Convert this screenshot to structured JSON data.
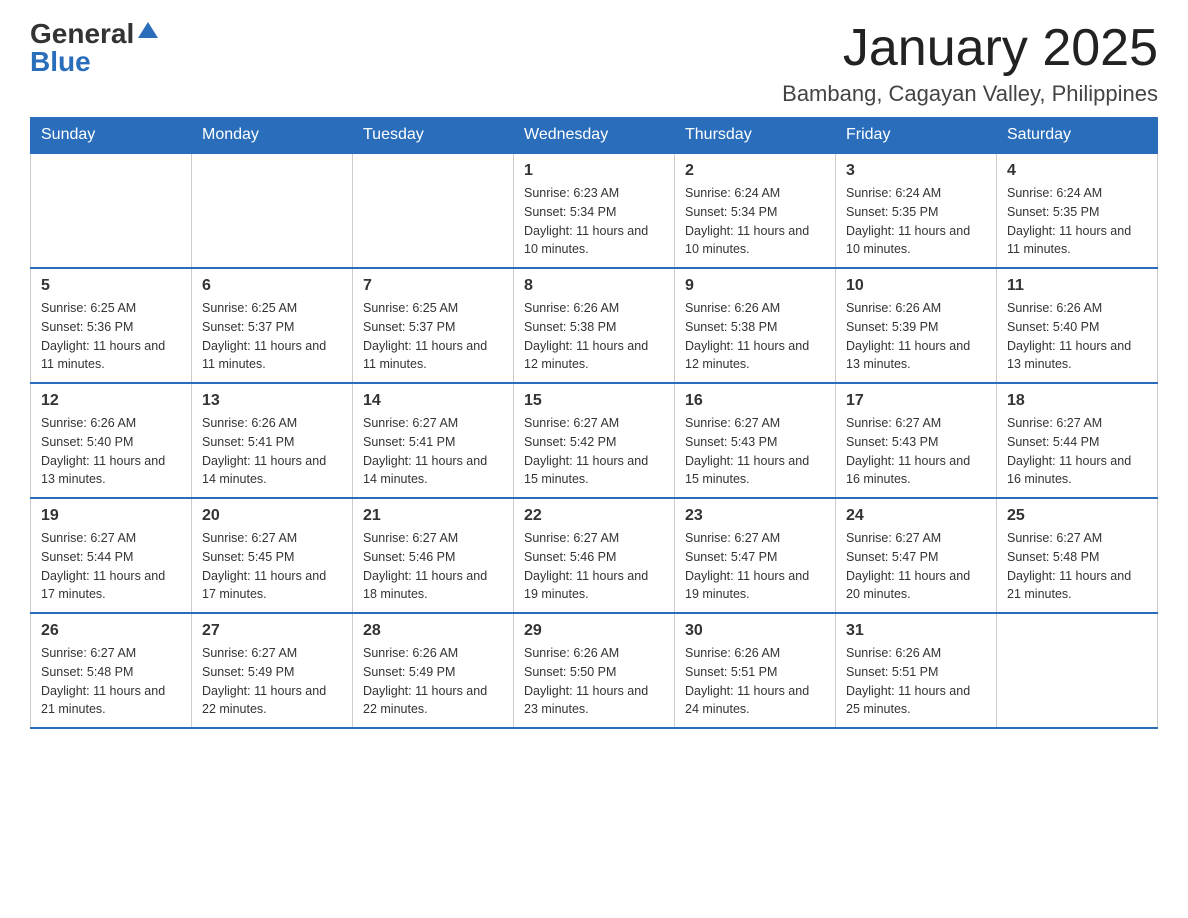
{
  "logo": {
    "general": "General",
    "blue": "Blue"
  },
  "header": {
    "month": "January 2025",
    "location": "Bambang, Cagayan Valley, Philippines"
  },
  "days_header": [
    "Sunday",
    "Monday",
    "Tuesday",
    "Wednesday",
    "Thursday",
    "Friday",
    "Saturday"
  ],
  "weeks": [
    [
      {
        "day": "",
        "info": ""
      },
      {
        "day": "",
        "info": ""
      },
      {
        "day": "",
        "info": ""
      },
      {
        "day": "1",
        "info": "Sunrise: 6:23 AM\nSunset: 5:34 PM\nDaylight: 11 hours and 10 minutes."
      },
      {
        "day": "2",
        "info": "Sunrise: 6:24 AM\nSunset: 5:34 PM\nDaylight: 11 hours and 10 minutes."
      },
      {
        "day": "3",
        "info": "Sunrise: 6:24 AM\nSunset: 5:35 PM\nDaylight: 11 hours and 10 minutes."
      },
      {
        "day": "4",
        "info": "Sunrise: 6:24 AM\nSunset: 5:35 PM\nDaylight: 11 hours and 11 minutes."
      }
    ],
    [
      {
        "day": "5",
        "info": "Sunrise: 6:25 AM\nSunset: 5:36 PM\nDaylight: 11 hours and 11 minutes."
      },
      {
        "day": "6",
        "info": "Sunrise: 6:25 AM\nSunset: 5:37 PM\nDaylight: 11 hours and 11 minutes."
      },
      {
        "day": "7",
        "info": "Sunrise: 6:25 AM\nSunset: 5:37 PM\nDaylight: 11 hours and 11 minutes."
      },
      {
        "day": "8",
        "info": "Sunrise: 6:26 AM\nSunset: 5:38 PM\nDaylight: 11 hours and 12 minutes."
      },
      {
        "day": "9",
        "info": "Sunrise: 6:26 AM\nSunset: 5:38 PM\nDaylight: 11 hours and 12 minutes."
      },
      {
        "day": "10",
        "info": "Sunrise: 6:26 AM\nSunset: 5:39 PM\nDaylight: 11 hours and 13 minutes."
      },
      {
        "day": "11",
        "info": "Sunrise: 6:26 AM\nSunset: 5:40 PM\nDaylight: 11 hours and 13 minutes."
      }
    ],
    [
      {
        "day": "12",
        "info": "Sunrise: 6:26 AM\nSunset: 5:40 PM\nDaylight: 11 hours and 13 minutes."
      },
      {
        "day": "13",
        "info": "Sunrise: 6:26 AM\nSunset: 5:41 PM\nDaylight: 11 hours and 14 minutes."
      },
      {
        "day": "14",
        "info": "Sunrise: 6:27 AM\nSunset: 5:41 PM\nDaylight: 11 hours and 14 minutes."
      },
      {
        "day": "15",
        "info": "Sunrise: 6:27 AM\nSunset: 5:42 PM\nDaylight: 11 hours and 15 minutes."
      },
      {
        "day": "16",
        "info": "Sunrise: 6:27 AM\nSunset: 5:43 PM\nDaylight: 11 hours and 15 minutes."
      },
      {
        "day": "17",
        "info": "Sunrise: 6:27 AM\nSunset: 5:43 PM\nDaylight: 11 hours and 16 minutes."
      },
      {
        "day": "18",
        "info": "Sunrise: 6:27 AM\nSunset: 5:44 PM\nDaylight: 11 hours and 16 minutes."
      }
    ],
    [
      {
        "day": "19",
        "info": "Sunrise: 6:27 AM\nSunset: 5:44 PM\nDaylight: 11 hours and 17 minutes."
      },
      {
        "day": "20",
        "info": "Sunrise: 6:27 AM\nSunset: 5:45 PM\nDaylight: 11 hours and 17 minutes."
      },
      {
        "day": "21",
        "info": "Sunrise: 6:27 AM\nSunset: 5:46 PM\nDaylight: 11 hours and 18 minutes."
      },
      {
        "day": "22",
        "info": "Sunrise: 6:27 AM\nSunset: 5:46 PM\nDaylight: 11 hours and 19 minutes."
      },
      {
        "day": "23",
        "info": "Sunrise: 6:27 AM\nSunset: 5:47 PM\nDaylight: 11 hours and 19 minutes."
      },
      {
        "day": "24",
        "info": "Sunrise: 6:27 AM\nSunset: 5:47 PM\nDaylight: 11 hours and 20 minutes."
      },
      {
        "day": "25",
        "info": "Sunrise: 6:27 AM\nSunset: 5:48 PM\nDaylight: 11 hours and 21 minutes."
      }
    ],
    [
      {
        "day": "26",
        "info": "Sunrise: 6:27 AM\nSunset: 5:48 PM\nDaylight: 11 hours and 21 minutes."
      },
      {
        "day": "27",
        "info": "Sunrise: 6:27 AM\nSunset: 5:49 PM\nDaylight: 11 hours and 22 minutes."
      },
      {
        "day": "28",
        "info": "Sunrise: 6:26 AM\nSunset: 5:49 PM\nDaylight: 11 hours and 22 minutes."
      },
      {
        "day": "29",
        "info": "Sunrise: 6:26 AM\nSunset: 5:50 PM\nDaylight: 11 hours and 23 minutes."
      },
      {
        "day": "30",
        "info": "Sunrise: 6:26 AM\nSunset: 5:51 PM\nDaylight: 11 hours and 24 minutes."
      },
      {
        "day": "31",
        "info": "Sunrise: 6:26 AM\nSunset: 5:51 PM\nDaylight: 11 hours and 25 minutes."
      },
      {
        "day": "",
        "info": ""
      }
    ]
  ]
}
